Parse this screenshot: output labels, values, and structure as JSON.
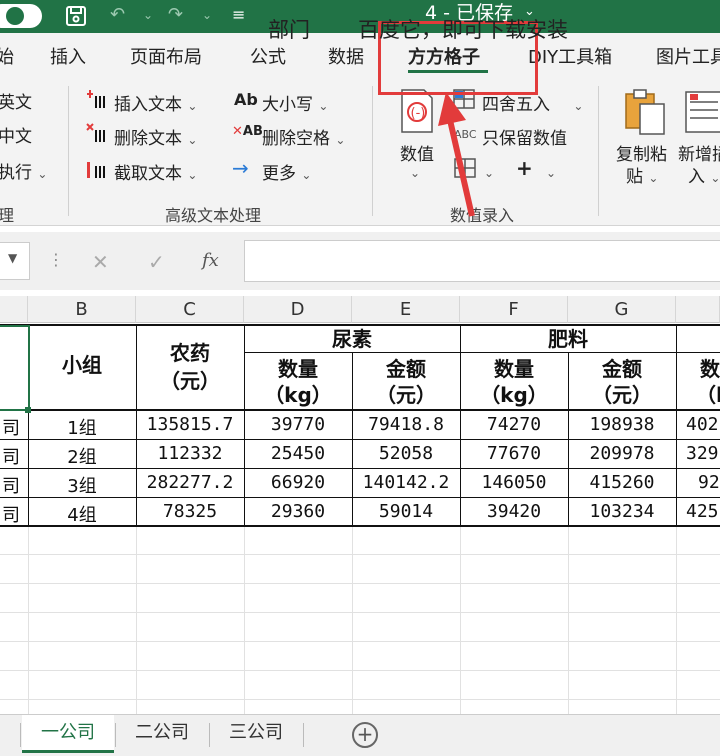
{
  "titlebar": {
    "title": "4 - 已保存",
    "title_chevron": "⌄",
    "save_icon": "save-icon",
    "undo": "↶",
    "redo": "↷",
    "more": "⌄"
  },
  "tabs": [
    {
      "label": "始",
      "active": false
    },
    {
      "label": "插入",
      "active": false
    },
    {
      "label": "页面布局",
      "active": false
    },
    {
      "label": "公式",
      "active": false
    },
    {
      "label": "数据",
      "active": false
    },
    {
      "label": "方方格子",
      "active": true
    },
    {
      "label": "DIY工具箱",
      "active": false
    },
    {
      "label": "图片工具",
      "active": false
    }
  ],
  "ribbon": {
    "left_col": [
      "英文",
      "中文",
      "执行"
    ],
    "left_group": "理",
    "text_cmds": {
      "insert": "插入文本",
      "delete": "删除文本",
      "cut": "截取文本",
      "case": "大小写",
      "space": "删除空格",
      "more": "更多",
      "case_icon": "Ab",
      "space_icon": "AB"
    },
    "text_group": "高级文本处理",
    "value": {
      "label": "数值",
      "round": "四舍五入",
      "keep": "只保留数值",
      "plus": "+"
    },
    "value_group": "数值录入",
    "paste": {
      "line1": "复制粘",
      "line2": "贴"
    },
    "newadd": {
      "line1": "新增插",
      "line2": "入"
    }
  },
  "formula": {
    "fx": "fx",
    "cancel": "✕",
    "confirm": "✓",
    "text1": "部门",
    "text2": "百度它，即可下载安装"
  },
  "grid": {
    "columns": [
      "B",
      "C",
      "D",
      "E",
      "F",
      "G"
    ],
    "headers": {
      "group": "小组",
      "pesticide": "农药",
      "pesticide_unit": "（元）",
      "urea": "尿素",
      "fertilizer": "肥料",
      "qty": "数量",
      "qty_unit": "（kg）",
      "amount": "金额",
      "amount_unit": "（元）",
      "partial_h": "数",
      "partial_u": "（l"
    },
    "rows": [
      {
        "a": "司",
        "group": "1组",
        "pesticide": "135815.7",
        "urea_qty": "39770",
        "urea_amt": "79418.8",
        "fert_qty": "74270",
        "fert_amt": "198938",
        "next": "402"
      },
      {
        "a": "司",
        "group": "2组",
        "pesticide": "112332",
        "urea_qty": "25450",
        "urea_amt": "52058",
        "fert_qty": "77670",
        "fert_amt": "209978",
        "next": "329"
      },
      {
        "a": "司",
        "group": "3组",
        "pesticide": "282277.2",
        "urea_qty": "66920",
        "urea_amt": "140142.2",
        "fert_qty": "146050",
        "fert_amt": "415260",
        "next": "92"
      },
      {
        "a": "司",
        "group": "4组",
        "pesticide": "78325",
        "urea_qty": "29360",
        "urea_amt": "59014",
        "fert_qty": "39420",
        "fert_amt": "103234",
        "next": "425"
      }
    ]
  },
  "sheets": [
    {
      "label": "一公司",
      "active": true
    },
    {
      "label": "二公司",
      "active": false
    },
    {
      "label": "三公司",
      "active": false
    }
  ],
  "colors": {
    "excel_green": "#217346",
    "highlight_red": "#e23b3b"
  }
}
